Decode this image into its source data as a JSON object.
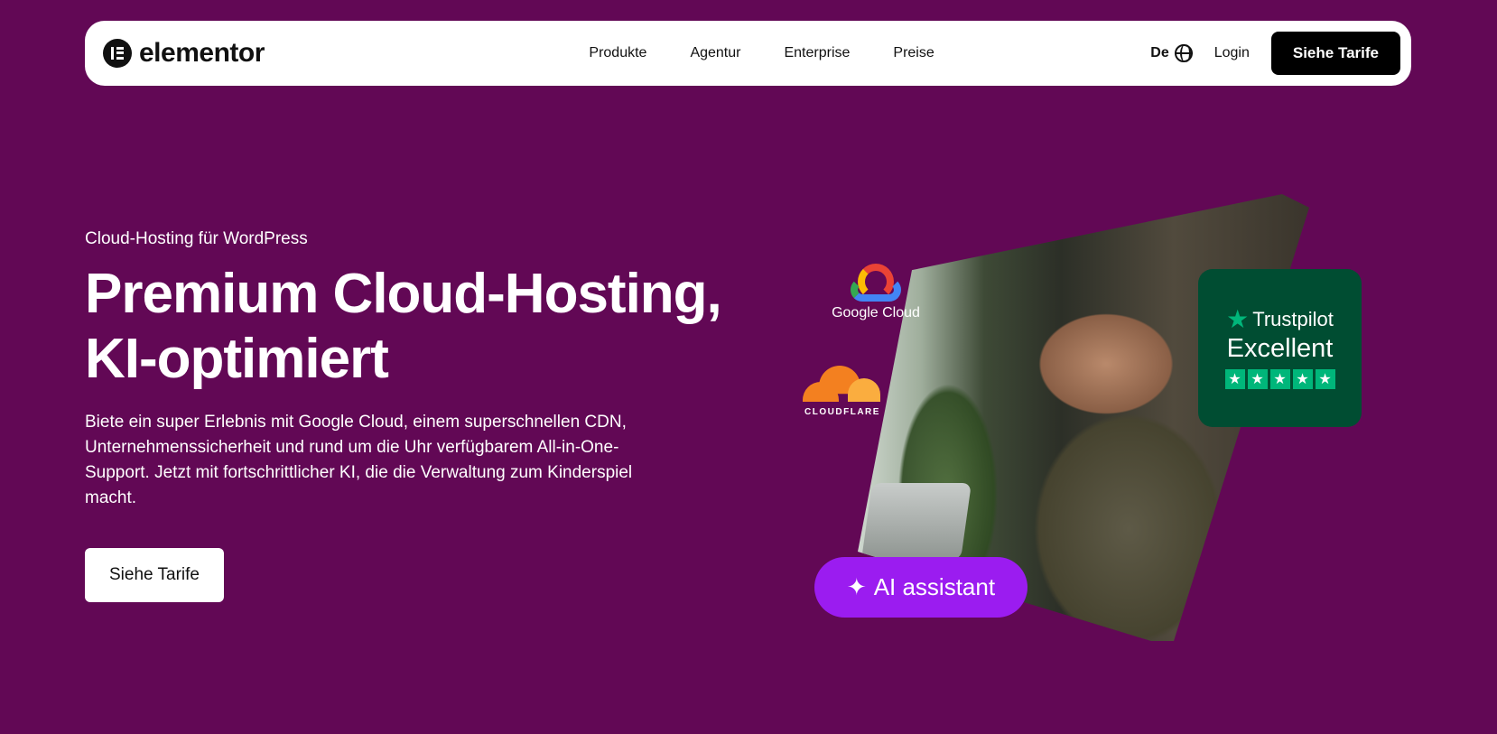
{
  "header": {
    "brand": "elementor",
    "nav": [
      "Produkte",
      "Agentur",
      "Enterprise",
      "Preise"
    ],
    "language": "De",
    "login_label": "Login",
    "cta_label": "Siehe Tarife"
  },
  "hero": {
    "eyebrow": "Cloud-Hosting für WordPress",
    "title_line1": "Premium Cloud-Hosting,",
    "title_line2": "KI-optimiert",
    "description": "Biete ein super Erlebnis mit Google Cloud, einem superschnellen CDN, Unternehmenssicherheit und rund um die Uhr verfügbarem All-in-One-Support. Jetzt mit fortschrittlicher KI, die die Verwaltung zum Kinderspiel macht.",
    "cta_label": "Siehe Tarife"
  },
  "visual": {
    "google_cloud_label": "Google Cloud",
    "cloudflare_label": "CLOUDFLARE",
    "trustpilot_brand": "Trustpilot",
    "trustpilot_rating": "Excellent",
    "trustpilot_stars": 5,
    "ai_label": "AI assistant"
  },
  "colors": {
    "background": "#620855",
    "trustpilot_bg": "#004d32",
    "trustpilot_green": "#00b67a",
    "ai_pill": "#9b1cf0"
  }
}
